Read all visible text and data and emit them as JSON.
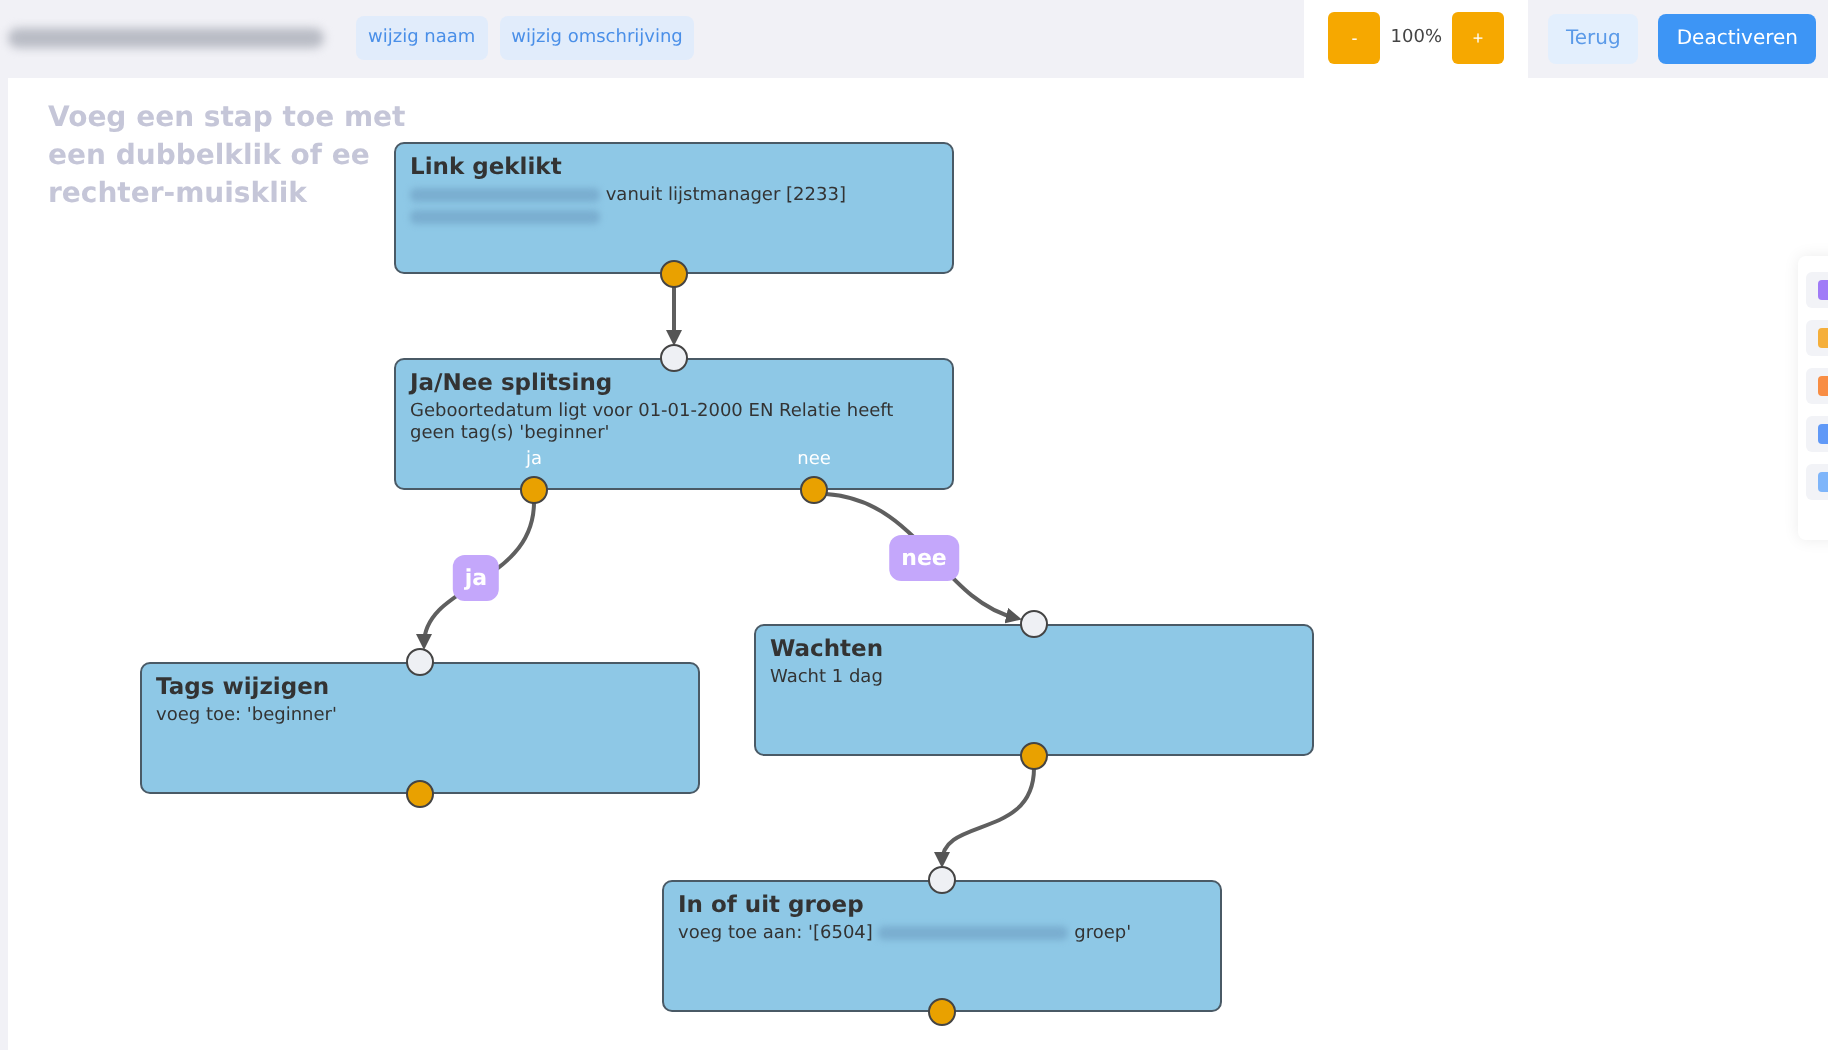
{
  "toolbar": {
    "buttons": [
      "wijzig naam",
      "wijzig omschrijving"
    ],
    "zoom_out": "-",
    "zoom_level": "100%",
    "zoom_in": "+",
    "back": "Terug",
    "deactivate": "Deactiveren"
  },
  "hint_lines": [
    "Voeg een stap toe met",
    "een dubbelklik of ee",
    "rechter-muisklik"
  ],
  "nodes": [
    {
      "title": "Link geklikt",
      "description": [
        {
          "kind": "blurred"
        },
        {
          "kind": "text",
          "text": " vanuit lijstmanager [2233]"
        },
        {
          "kind": "break"
        },
        {
          "kind": "blurred"
        }
      ]
    },
    {
      "title": "Ja/Nee splitsing",
      "description": [
        {
          "kind": "text",
          "text": "Geboortedatum ligt voor 01-01-2000 EN Relatie heeft geen tag(s) 'beginner'"
        }
      ],
      "ports": [
        "ja",
        "nee"
      ]
    },
    {
      "title": "Tags wijzigen",
      "description": [
        {
          "kind": "text",
          "text": "voeg toe: 'beginner'"
        }
      ]
    },
    {
      "title": "Wachten",
      "description": [
        {
          "kind": "text",
          "text": "Wacht 1 dag"
        }
      ]
    },
    {
      "title": "In of uit groep",
      "description": [
        {
          "kind": "text",
          "text": "voeg toe aan: '[6504] "
        },
        {
          "kind": "blurred"
        },
        {
          "kind": "text",
          "text": " groep'"
        }
      ]
    }
  ],
  "edge_labels": [
    "ja",
    "nee"
  ]
}
